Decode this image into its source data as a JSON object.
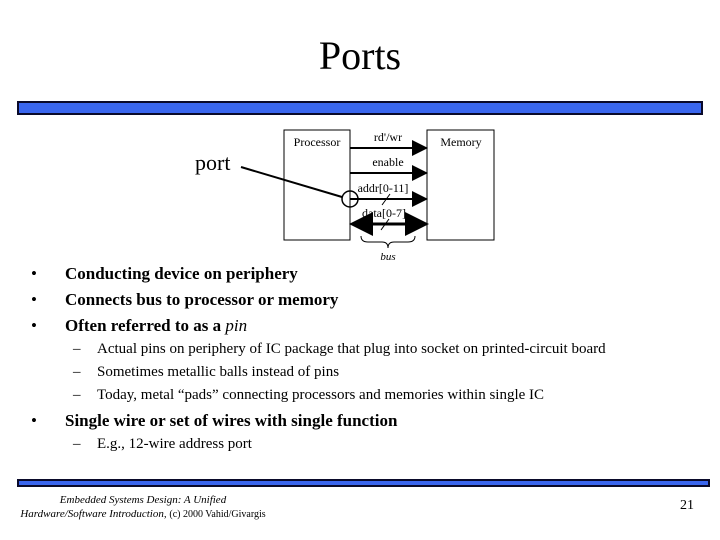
{
  "slide": {
    "title": "Ports",
    "page_number": "21",
    "colors": {
      "accent_bar": "#3a66ee",
      "bar_border": "#0a0a2a"
    }
  },
  "diagram": {
    "port_label": "port",
    "processor_label": "Processor",
    "memory_label": "Memory",
    "signals": [
      {
        "label": "rd'/wr",
        "direction": "to-memory"
      },
      {
        "label": "enable",
        "direction": "to-memory"
      },
      {
        "label": "addr[0-11]",
        "direction": "to-memory"
      },
      {
        "label": "data[0-7]",
        "direction": "bidirectional"
      }
    ],
    "bus_label": "bus"
  },
  "bullets": [
    {
      "text": "Conducting device on periphery"
    },
    {
      "text": "Connects bus to processor or memory"
    },
    {
      "text": "Often referred to as a ",
      "emph": "pin",
      "sub": [
        "Actual pins on periphery of IC package that plug into socket on printed-circuit board",
        "Sometimes metallic balls instead of pins",
        "Today, metal “pads” connecting processors and memories within single IC"
      ]
    },
    {
      "text": "Single wire or set of wires with single function",
      "sub": [
        "E.g., 12-wire address port"
      ]
    }
  ],
  "footer": {
    "line1": "Embedded Systems Design: A Unified",
    "line2": "Hardware/Software Introduction,",
    "copyright": "(c) 2000 Vahid/Givargis"
  }
}
